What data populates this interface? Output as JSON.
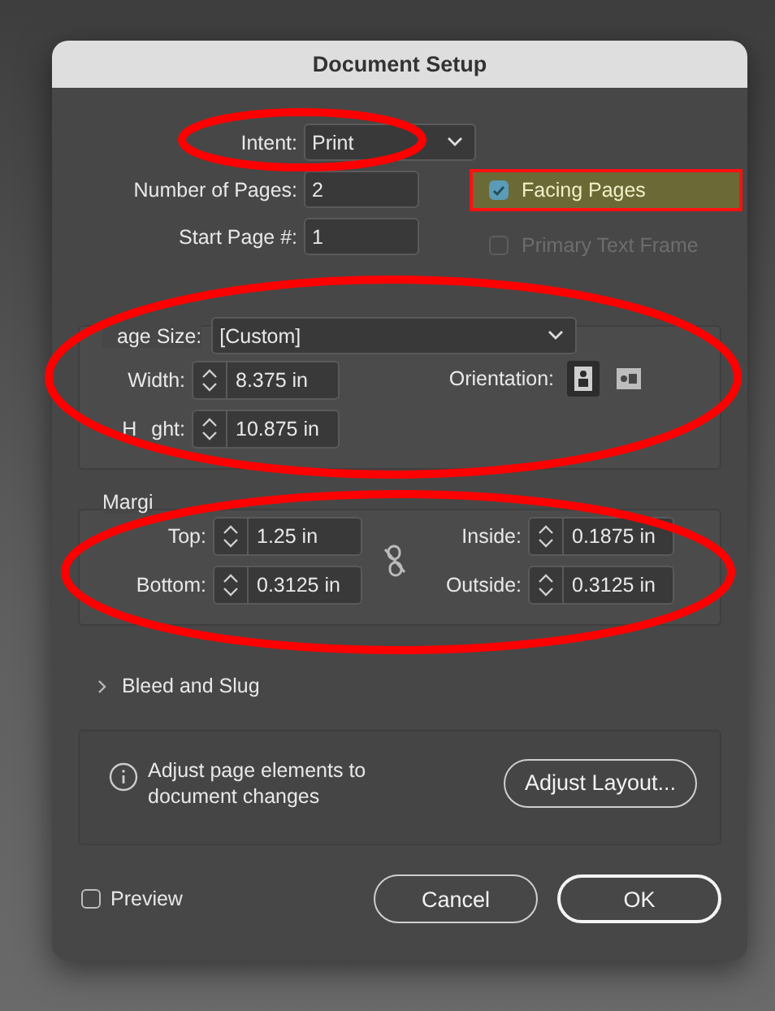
{
  "window": {
    "title": "Document Setup"
  },
  "intent": {
    "label": "Intent:",
    "value": "Print"
  },
  "pages": {
    "label": "Number of Pages:",
    "value": "2"
  },
  "start_page": {
    "label": "Start Page #:",
    "value": "1"
  },
  "options": [
    {
      "label": "Facing Pages",
      "checked": true,
      "disabled": false,
      "highlighted": true
    },
    {
      "label": "Primary Text Frame",
      "checked": false,
      "disabled": true,
      "highlighted": false
    }
  ],
  "page_size": {
    "label": "age Size:",
    "value": "[Custom]",
    "width": {
      "label": "Width:",
      "value": "8.375 in"
    },
    "height": {
      "label_parts": [
        "H",
        "ght:"
      ],
      "value": "10.875 in"
    },
    "orientation": {
      "label": "Orientation:",
      "options": [
        {
          "kind": "portrait",
          "selected": true
        },
        {
          "kind": "landscape",
          "selected": false
        }
      ]
    }
  },
  "margins": {
    "title": "Margi",
    "linked": false,
    "fields": [
      {
        "label": "Top:",
        "value": "1.25 in"
      },
      {
        "label": "Bottom:",
        "value": "0.3125 in"
      },
      {
        "label": "Inside:",
        "value": "0.1875 in"
      },
      {
        "label": "Outside:",
        "value": "0.3125 in"
      }
    ]
  },
  "bleed_and_slug": {
    "label": "Bleed and Slug",
    "expanded": false
  },
  "info": {
    "text": "Adjust page elements to document changes",
    "button": "Adjust Layout..."
  },
  "preview": {
    "label": "Preview",
    "checked": false
  },
  "buttons": [
    {
      "label": "Cancel",
      "default": false
    },
    {
      "label": "OK",
      "default": true
    }
  ],
  "annotations": [
    {
      "kind": "ellipse"
    },
    {
      "kind": "ellipse"
    },
    {
      "kind": "ellipse"
    }
  ]
}
